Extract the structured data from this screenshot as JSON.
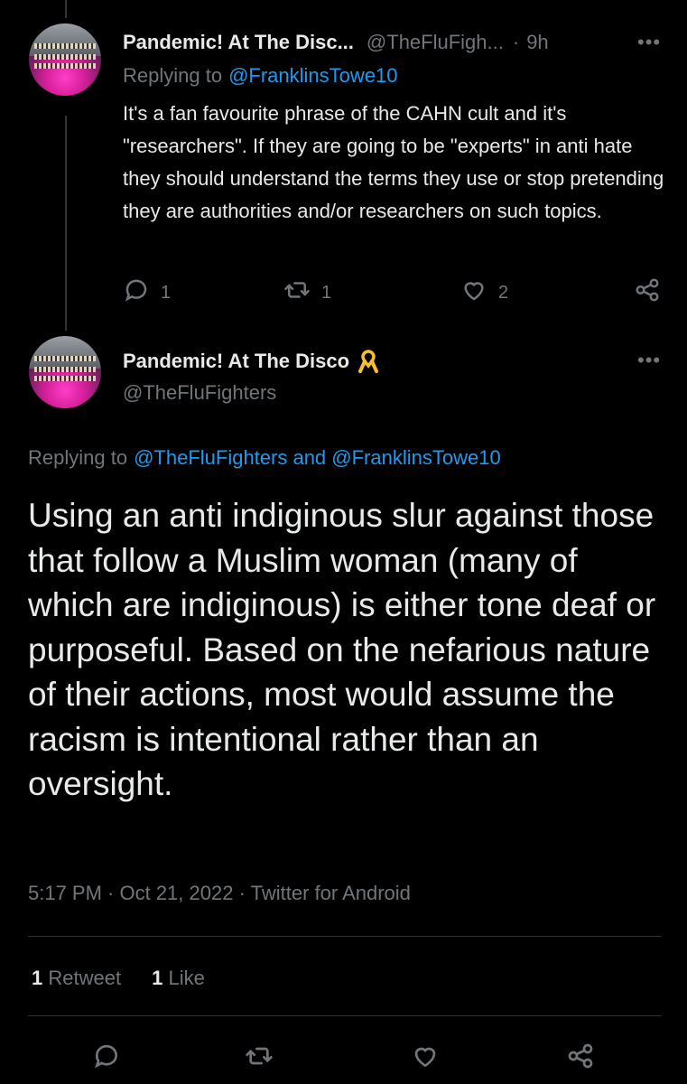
{
  "reply_tweet": {
    "display_name": "Pandemic! At The Disc...",
    "handle": "@TheFluFigh...",
    "separator": "·",
    "time": "9h",
    "replying_to_prefix": "Replying to",
    "replying_to_handle": "@FranklinsTowe10",
    "text": "It's a fan favourite phrase of the CAHN cult and it's \"researchers\". If they are going to be \"experts\" in anti hate they should understand the terms they use or stop pretending they are authorities and/or researchers on such topics.",
    "reply_count": "1",
    "retweet_count": "1",
    "like_count": "2"
  },
  "main_tweet": {
    "display_name": "Pandemic! At The Disco",
    "handle": "@TheFluFighters",
    "replying_to_prefix": "Replying to",
    "replying_to_handles": "@TheFluFighters and @FranklinsTowe10",
    "text": "Using an anti indiginous slur against those that follow a Muslim woman (many of which are indiginous) is either tone deaf or purposeful. Based on the nefarious nature of their actions, most would assume the racism is intentional rather than an oversight.",
    "timestamp": "5:17 PM · Oct 21, 2022 · Twitter for Android",
    "retweets_count": "1",
    "retweets_label": "Retweet",
    "likes_count": "1",
    "likes_label": "Like"
  },
  "more_glyph": "•••",
  "colors": {
    "background": "#000000",
    "text": "#e7e9ea",
    "muted": "#71767b",
    "link": "#1d9bf0",
    "ribbon": "#f5c02b"
  },
  "icons": [
    "more-icon",
    "reply-icon",
    "retweet-icon",
    "like-icon",
    "share-icon",
    "ribbon-icon"
  ]
}
